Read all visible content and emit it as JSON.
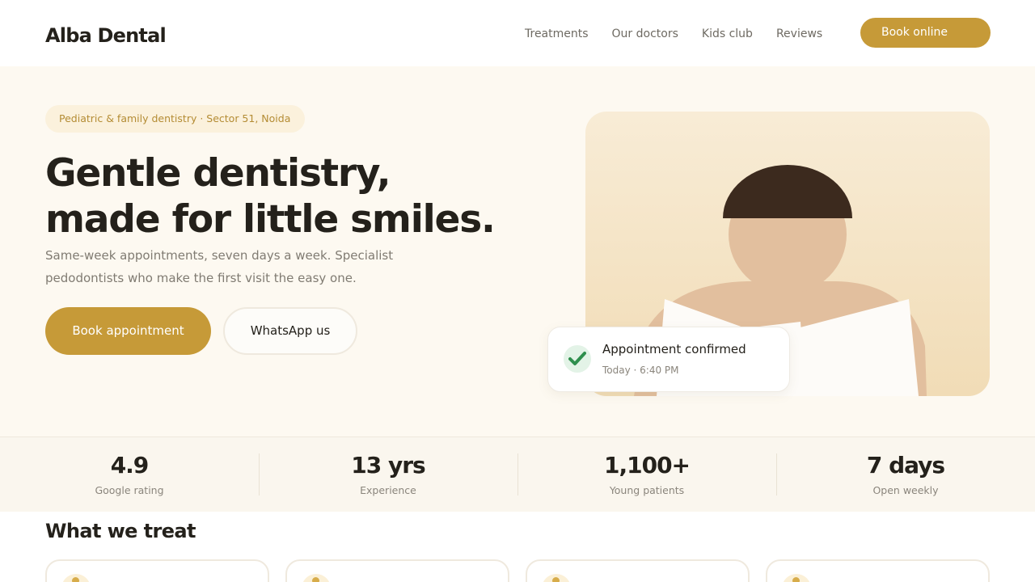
{
  "header": {
    "logo": "Alba Dental",
    "nav": [
      "Treatments",
      "Our doctors",
      "Kids club",
      "Reviews"
    ],
    "cta": "Book online"
  },
  "hero": {
    "pill": "Pediatric & family dentistry · Sector 51, Noida",
    "headline_line1": "Gentle dentistry,",
    "headline_line2": "made for little smiles.",
    "subtitle": "Same-week appointments, seven days a week. Specialist pedodontists who make the first visit the easy one.",
    "primary_button": "Book appointment",
    "secondary_button": "WhatsApp us"
  },
  "toast": {
    "title": "Appointment confirmed",
    "detail": "Today · 6:40 PM"
  },
  "stats": [
    {
      "value": "4.9",
      "label": "Google rating"
    },
    {
      "value": "13 yrs",
      "label": "Experience"
    },
    {
      "value": "1,100+",
      "label": "Young patients"
    },
    {
      "value": "7 days",
      "label": "Open weekly"
    }
  ],
  "treat": {
    "title": "What we treat"
  },
  "colors": {
    "accent": "#c69a38",
    "hero_bg": "#fdf9f1",
    "text": "#24211b",
    "success": "#2f8f4e"
  },
  "icons": [
    "check-icon"
  ]
}
